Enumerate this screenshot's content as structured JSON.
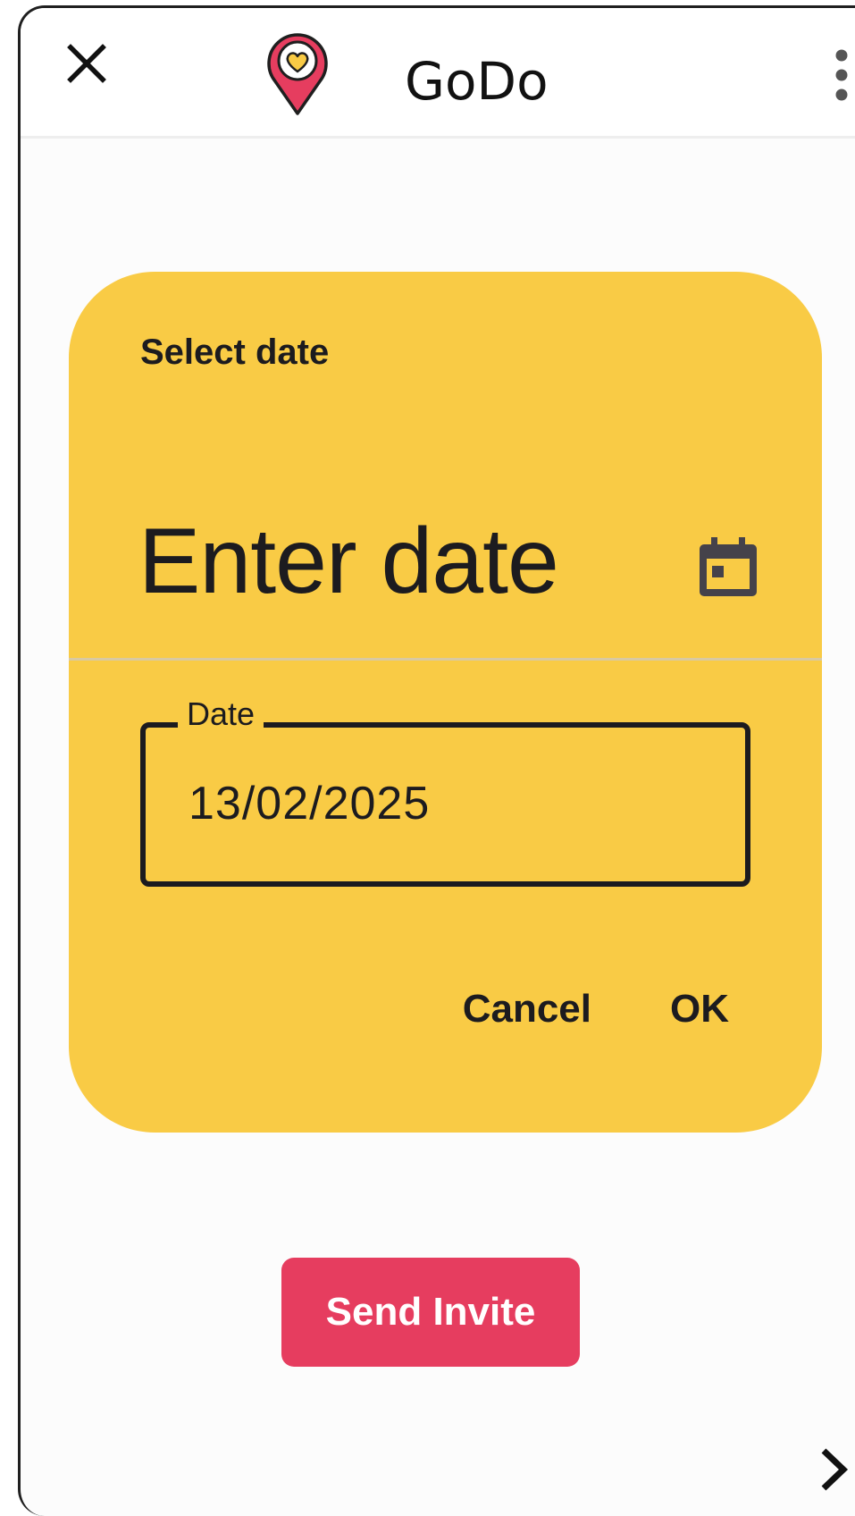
{
  "app": {
    "title": "GoDo",
    "colors": {
      "accent": "#f9cb45",
      "primary_button": "#e63d5f",
      "text": "#1c1b1f"
    },
    "icons": {
      "close": "close-icon",
      "logo": "heart-location-pin-icon",
      "more": "more-vert-icon",
      "calendar": "calendar-icon",
      "next": "chevron-right-icon"
    }
  },
  "dialog": {
    "heading": "Select date",
    "headline": "Enter date",
    "field": {
      "label": "Date",
      "value": "13/02/2025"
    },
    "actions": {
      "cancel": "Cancel",
      "ok": "OK"
    }
  },
  "main": {
    "send_invite_label": "Send Invite"
  }
}
